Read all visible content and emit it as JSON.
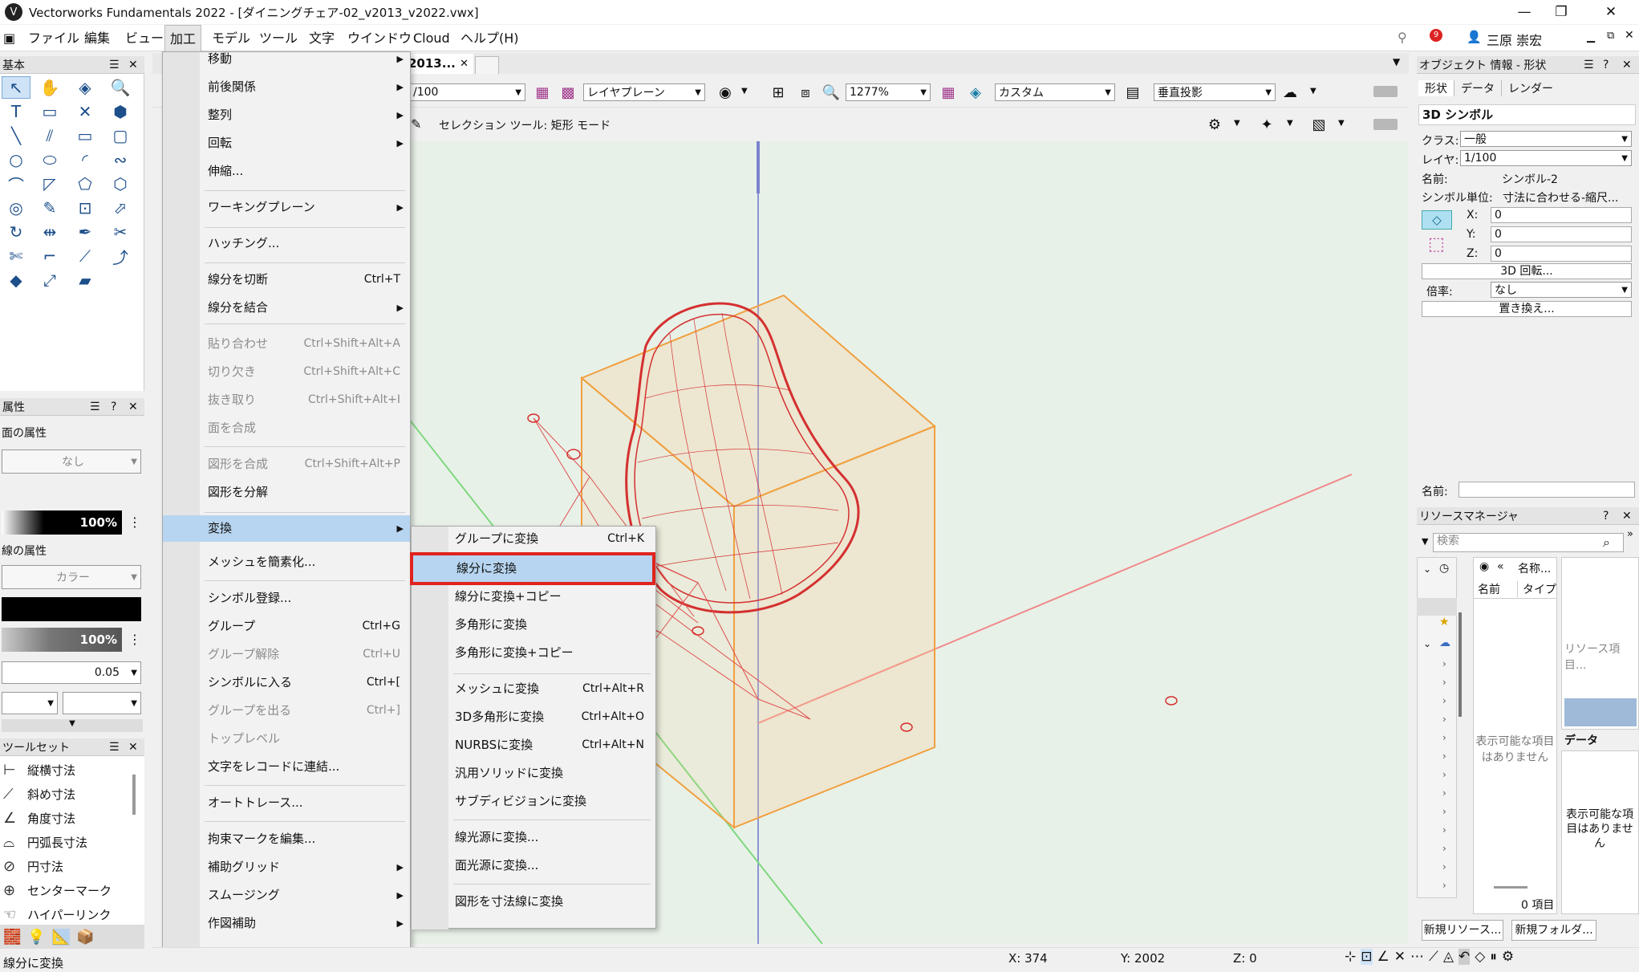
{
  "window": {
    "title": "Vectorworks Fundamentals 2022 - [ダイニングチェア-02_v2013_v2022.vwx]",
    "app_icon": "V",
    "min": "—",
    "max": "❐",
    "close": "✕"
  },
  "menubar": {
    "items": [
      "ファイル",
      "編集",
      "ビュー",
      "加工",
      "モデル",
      "ツール",
      "文字",
      "ウインドウ",
      "Cloud",
      "ヘルプ(H)"
    ],
    "user": "三原 崇宏",
    "notification_count": "9"
  },
  "doc_tab": {
    "label": "2013...",
    "close": "✕"
  },
  "view_bar": {
    "scale": "/100",
    "layer_plane": "レイヤプレーン",
    "zoom": "1277%",
    "render_mode": "カスタム",
    "projection": "垂直投影"
  },
  "mode_bar": {
    "text": "セレクション ツール: 矩形 モード"
  },
  "left": {
    "basic_title": "基本",
    "attr_title": "属性",
    "fill_label": "面の属性",
    "fill_value": "なし",
    "fill_opacity": "100%",
    "line_label": "線の属性",
    "line_value": "カラー",
    "line_opacity": "100%",
    "line_weight": "0.05",
    "toolset_title": "ツールセット",
    "toolset_items": [
      "縦横寸法",
      "斜め寸法",
      "角度寸法",
      "円弧長寸法",
      "円寸法",
      "センターマーク",
      "ハイパーリンク"
    ],
    "status_text": "線分に変換"
  },
  "main_menu": {
    "items": [
      {
        "label": "移動",
        "sc": "",
        "sub": true,
        "dis": false
      },
      {
        "label": "前後関係",
        "sc": "",
        "sub": true,
        "dis": false
      },
      {
        "label": "整列",
        "sc": "",
        "sub": true,
        "dis": false
      },
      {
        "label": "回転",
        "sc": "",
        "sub": true,
        "dis": false
      },
      {
        "label": "伸縮...",
        "sc": "",
        "sub": false,
        "dis": false
      },
      {
        "label": "ワーキングプレーン",
        "sc": "",
        "sub": true,
        "dis": false
      },
      {
        "label": "ハッチング...",
        "sc": "",
        "sub": false,
        "dis": false
      },
      {
        "label": "線分を切断",
        "sc": "Ctrl+T",
        "sub": false,
        "dis": false
      },
      {
        "label": "線分を結合",
        "sc": "",
        "sub": true,
        "dis": false
      },
      {
        "label": "貼り合わせ",
        "sc": "Ctrl+Shift+Alt+A",
        "sub": false,
        "dis": true
      },
      {
        "label": "切り欠き",
        "sc": "Ctrl+Shift+Alt+C",
        "sub": false,
        "dis": true
      },
      {
        "label": "抜き取り",
        "sc": "Ctrl+Shift+Alt+I",
        "sub": false,
        "dis": true
      },
      {
        "label": "面を合成",
        "sc": "",
        "sub": false,
        "dis": true
      },
      {
        "label": "図形を合成",
        "sc": "Ctrl+Shift+Alt+P",
        "sub": false,
        "dis": true
      },
      {
        "label": "図形を分解",
        "sc": "",
        "sub": false,
        "dis": false
      },
      {
        "label": "変換",
        "sc": "",
        "sub": true,
        "dis": false
      },
      {
        "label": "メッシュを簡素化...",
        "sc": "",
        "sub": false,
        "dis": false
      },
      {
        "label": "シンボル登録...",
        "sc": "",
        "sub": false,
        "dis": false
      },
      {
        "label": "グループ",
        "sc": "Ctrl+G",
        "sub": false,
        "dis": false
      },
      {
        "label": "グループ解除",
        "sc": "Ctrl+U",
        "sub": false,
        "dis": true
      },
      {
        "label": "シンボルに入る",
        "sc": "Ctrl+[",
        "sub": false,
        "dis": false
      },
      {
        "label": "グループを出る",
        "sc": "Ctrl+]",
        "sub": false,
        "dis": true
      },
      {
        "label": "トップレベル",
        "sc": "",
        "sub": false,
        "dis": true
      },
      {
        "label": "文字をレコードに連結...",
        "sc": "",
        "sub": false,
        "dis": false
      },
      {
        "label": "オートトレース...",
        "sc": "",
        "sub": false,
        "dis": false
      },
      {
        "label": "拘束マークを編集...",
        "sc": "",
        "sub": false,
        "dis": false
      },
      {
        "label": "補助グリッド",
        "sc": "",
        "sub": true,
        "dis": false
      },
      {
        "label": "スムージング",
        "sc": "",
        "sub": true,
        "dis": false
      },
      {
        "label": "作図補助",
        "sc": "",
        "sub": true,
        "dis": false
      }
    ],
    "more": "▾"
  },
  "sub_menu": {
    "items": [
      {
        "label": "グループに変換",
        "sc": "Ctrl+K"
      },
      {
        "label": "線分に変換",
        "sc": ""
      },
      {
        "label": "線分に変換+コピー",
        "sc": ""
      },
      {
        "label": "多角形に変換",
        "sc": ""
      },
      {
        "label": "多角形に変換+コピー",
        "sc": ""
      },
      {
        "label": "メッシュに変換",
        "sc": "Ctrl+Alt+R"
      },
      {
        "label": "3D多角形に変換",
        "sc": "Ctrl+Alt+O"
      },
      {
        "label": "NURBSに変換",
        "sc": "Ctrl+Alt+N"
      },
      {
        "label": "汎用ソリッドに変換",
        "sc": ""
      },
      {
        "label": "サブディビジョンに変換",
        "sc": ""
      },
      {
        "label": "線光源に変換...",
        "sc": ""
      },
      {
        "label": "面光源に変換...",
        "sc": ""
      },
      {
        "label": "図形を寸法線に変換",
        "sc": ""
      }
    ],
    "highlight_color": "#e0231e"
  },
  "oip": {
    "title": "オブジェクト 情報 - 形状",
    "tabs": [
      "形状",
      "データ",
      "レンダー"
    ],
    "object_type": "3D シンボル",
    "class_label": "クラス:",
    "class_value": "一般",
    "layer_label": "レイヤ:",
    "layer_value": "1/100",
    "name_label": "名前:",
    "name_value": "シンボル-2",
    "unit_label": "シンボル単位:",
    "unit_value": "寸法に合わせる-縮尺...",
    "x_label": "X:",
    "x_value": "0",
    "y_label": "Y:",
    "y_value": "0",
    "z_label": "Z:",
    "z_value": "0",
    "rotate_button": "3D 回転...",
    "scale_label": "倍率:",
    "scale_value": "なし",
    "replace_button": "置き換え...",
    "bottom_name_label": "名前:"
  },
  "resource": {
    "title": "リソースマネージャ",
    "search_placeholder": "検索",
    "col_name_header": "名称...",
    "col_name": "名前",
    "col_type": "タイプ",
    "empty_text": "表示可能な項目はありません",
    "count": "0 項目",
    "preview_label": "リソース項目...",
    "data_title": "データ",
    "data_empty": "表示可能な項目はありません",
    "new_resource_button": "新規リソース...",
    "new_folder_button": "新規フォルダ..."
  },
  "statusbar": {
    "x": "X: 374",
    "y": "Y: 2002",
    "z": "Z: 0"
  }
}
